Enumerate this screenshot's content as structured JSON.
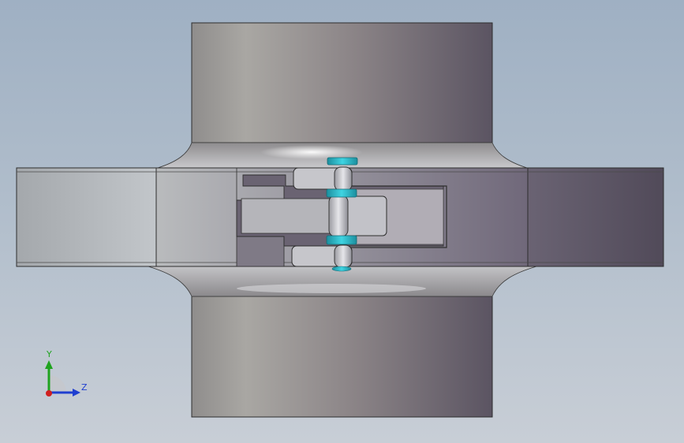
{
  "viewport": {
    "background_top": "#9fb0c3",
    "background_bottom": "#c8ced6",
    "part_shading_light": "#b8b8b8",
    "part_shading_dark": "#5f5865",
    "highlight_color": "#2ab8c8"
  },
  "triad": {
    "y_label": "Y",
    "z_label": "Z",
    "y_color": "#1fa31f",
    "z_color": "#1f3fd0",
    "x_color": "#d01f1f",
    "icon": "coordinate-triad-icon"
  }
}
